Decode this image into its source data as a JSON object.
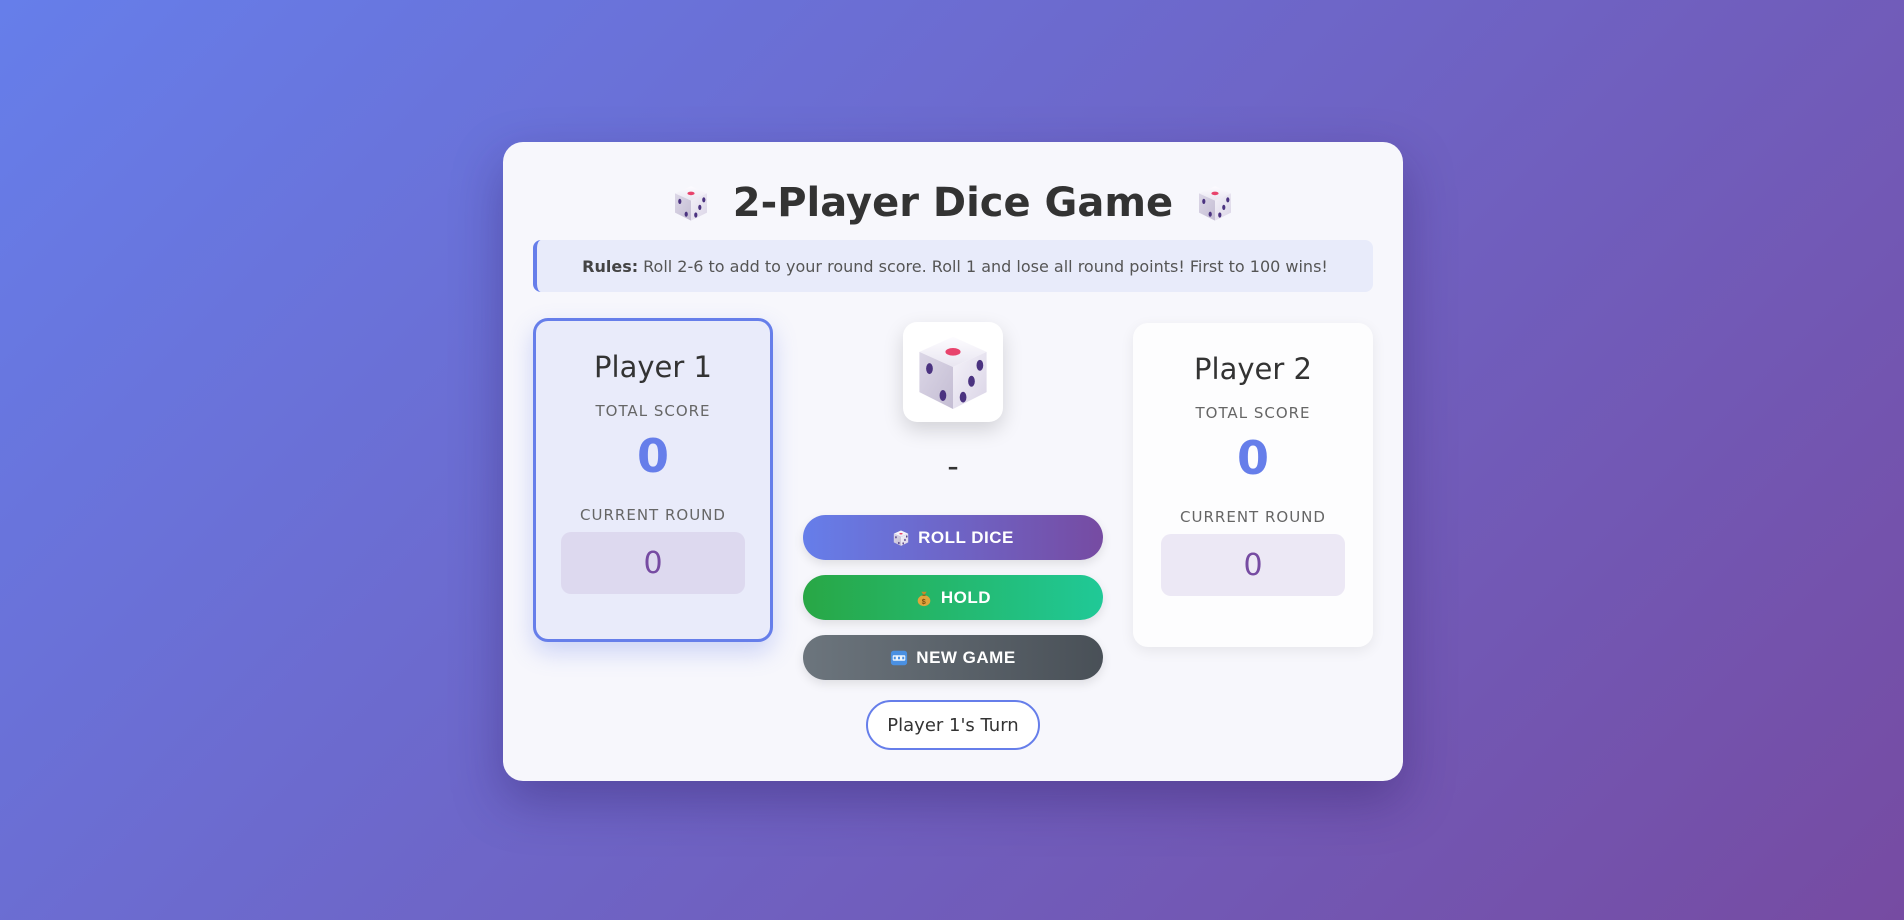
{
  "header": {
    "title": "2-Player Dice Game"
  },
  "rules": {
    "label": "Rules:",
    "text": "Roll 2-6 to add to your round score. Roll 1 and lose all round points! First to 100 wins!"
  },
  "players": [
    {
      "name": "Player 1",
      "total_label": "TOTAL SCORE",
      "total": "0",
      "round_label": "CURRENT ROUND",
      "round": "0",
      "active": true
    },
    {
      "name": "Player 2",
      "total_label": "TOTAL SCORE",
      "total": "0",
      "round_label": "CURRENT ROUND",
      "round": "0",
      "active": false
    }
  ],
  "dice": {
    "icon": "dice-icon",
    "result": "-"
  },
  "buttons": {
    "roll": {
      "label": "ROLL DICE",
      "icon": "dice-icon"
    },
    "hold": {
      "label": "HOLD",
      "icon": "money-bag-icon"
    },
    "new_game": {
      "label": "NEW GAME",
      "icon": "new-badge-icon"
    }
  },
  "turn": {
    "text": "Player 1's Turn"
  },
  "colors": {
    "accent": "#667eea",
    "secondary": "#764ba2",
    "hold": "#28a745",
    "new_game": "#6c757d"
  }
}
